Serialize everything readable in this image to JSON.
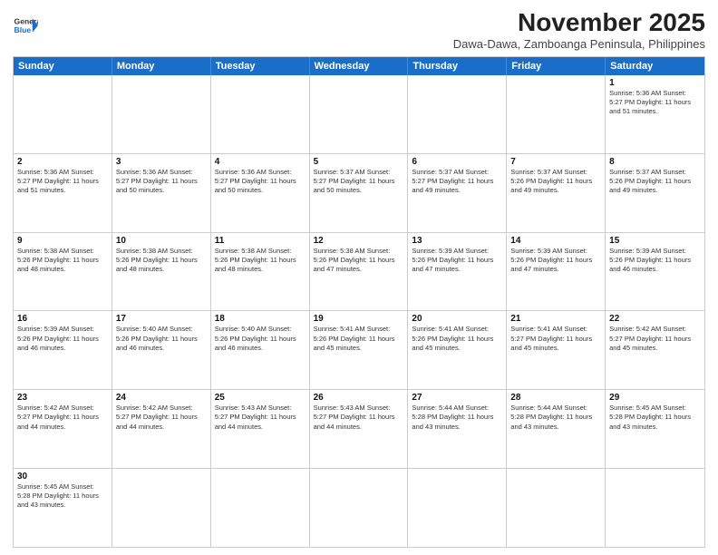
{
  "header": {
    "logo_general": "General",
    "logo_blue": "Blue",
    "month_title": "November 2025",
    "subtitle": "Dawa-Dawa, Zamboanga Peninsula, Philippines"
  },
  "weekdays": [
    "Sunday",
    "Monday",
    "Tuesday",
    "Wednesday",
    "Thursday",
    "Friday",
    "Saturday"
  ],
  "rows": [
    [
      {
        "day": "",
        "info": ""
      },
      {
        "day": "",
        "info": ""
      },
      {
        "day": "",
        "info": ""
      },
      {
        "day": "",
        "info": ""
      },
      {
        "day": "",
        "info": ""
      },
      {
        "day": "",
        "info": ""
      },
      {
        "day": "1",
        "info": "Sunrise: 5:36 AM\nSunset: 5:27 PM\nDaylight: 11 hours and 51 minutes."
      }
    ],
    [
      {
        "day": "2",
        "info": "Sunrise: 5:36 AM\nSunset: 5:27 PM\nDaylight: 11 hours and 51 minutes."
      },
      {
        "day": "3",
        "info": "Sunrise: 5:36 AM\nSunset: 5:27 PM\nDaylight: 11 hours and 50 minutes."
      },
      {
        "day": "4",
        "info": "Sunrise: 5:36 AM\nSunset: 5:27 PM\nDaylight: 11 hours and 50 minutes."
      },
      {
        "day": "5",
        "info": "Sunrise: 5:37 AM\nSunset: 5:27 PM\nDaylight: 11 hours and 50 minutes."
      },
      {
        "day": "6",
        "info": "Sunrise: 5:37 AM\nSunset: 5:27 PM\nDaylight: 11 hours and 49 minutes."
      },
      {
        "day": "7",
        "info": "Sunrise: 5:37 AM\nSunset: 5:26 PM\nDaylight: 11 hours and 49 minutes."
      },
      {
        "day": "8",
        "info": "Sunrise: 5:37 AM\nSunset: 5:26 PM\nDaylight: 11 hours and 49 minutes."
      }
    ],
    [
      {
        "day": "9",
        "info": "Sunrise: 5:38 AM\nSunset: 5:26 PM\nDaylight: 11 hours and 48 minutes."
      },
      {
        "day": "10",
        "info": "Sunrise: 5:38 AM\nSunset: 5:26 PM\nDaylight: 11 hours and 48 minutes."
      },
      {
        "day": "11",
        "info": "Sunrise: 5:38 AM\nSunset: 5:26 PM\nDaylight: 11 hours and 48 minutes."
      },
      {
        "day": "12",
        "info": "Sunrise: 5:38 AM\nSunset: 5:26 PM\nDaylight: 11 hours and 47 minutes."
      },
      {
        "day": "13",
        "info": "Sunrise: 5:39 AM\nSunset: 5:26 PM\nDaylight: 11 hours and 47 minutes."
      },
      {
        "day": "14",
        "info": "Sunrise: 5:39 AM\nSunset: 5:26 PM\nDaylight: 11 hours and 47 minutes."
      },
      {
        "day": "15",
        "info": "Sunrise: 5:39 AM\nSunset: 5:26 PM\nDaylight: 11 hours and 46 minutes."
      }
    ],
    [
      {
        "day": "16",
        "info": "Sunrise: 5:39 AM\nSunset: 5:26 PM\nDaylight: 11 hours and 46 minutes."
      },
      {
        "day": "17",
        "info": "Sunrise: 5:40 AM\nSunset: 5:26 PM\nDaylight: 11 hours and 46 minutes."
      },
      {
        "day": "18",
        "info": "Sunrise: 5:40 AM\nSunset: 5:26 PM\nDaylight: 11 hours and 46 minutes."
      },
      {
        "day": "19",
        "info": "Sunrise: 5:41 AM\nSunset: 5:26 PM\nDaylight: 11 hours and 45 minutes."
      },
      {
        "day": "20",
        "info": "Sunrise: 5:41 AM\nSunset: 5:26 PM\nDaylight: 11 hours and 45 minutes."
      },
      {
        "day": "21",
        "info": "Sunrise: 5:41 AM\nSunset: 5:27 PM\nDaylight: 11 hours and 45 minutes."
      },
      {
        "day": "22",
        "info": "Sunrise: 5:42 AM\nSunset: 5:27 PM\nDaylight: 11 hours and 45 minutes."
      }
    ],
    [
      {
        "day": "23",
        "info": "Sunrise: 5:42 AM\nSunset: 5:27 PM\nDaylight: 11 hours and 44 minutes."
      },
      {
        "day": "24",
        "info": "Sunrise: 5:42 AM\nSunset: 5:27 PM\nDaylight: 11 hours and 44 minutes."
      },
      {
        "day": "25",
        "info": "Sunrise: 5:43 AM\nSunset: 5:27 PM\nDaylight: 11 hours and 44 minutes."
      },
      {
        "day": "26",
        "info": "Sunrise: 5:43 AM\nSunset: 5:27 PM\nDaylight: 11 hours and 44 minutes."
      },
      {
        "day": "27",
        "info": "Sunrise: 5:44 AM\nSunset: 5:28 PM\nDaylight: 11 hours and 43 minutes."
      },
      {
        "day": "28",
        "info": "Sunrise: 5:44 AM\nSunset: 5:28 PM\nDaylight: 11 hours and 43 minutes."
      },
      {
        "day": "29",
        "info": "Sunrise: 5:45 AM\nSunset: 5:28 PM\nDaylight: 11 hours and 43 minutes."
      }
    ],
    [
      {
        "day": "30",
        "info": "Sunrise: 5:45 AM\nSunset: 5:28 PM\nDaylight: 11 hours and 43 minutes."
      },
      {
        "day": "",
        "info": ""
      },
      {
        "day": "",
        "info": ""
      },
      {
        "day": "",
        "info": ""
      },
      {
        "day": "",
        "info": ""
      },
      {
        "day": "",
        "info": ""
      },
      {
        "day": "",
        "info": ""
      }
    ]
  ]
}
